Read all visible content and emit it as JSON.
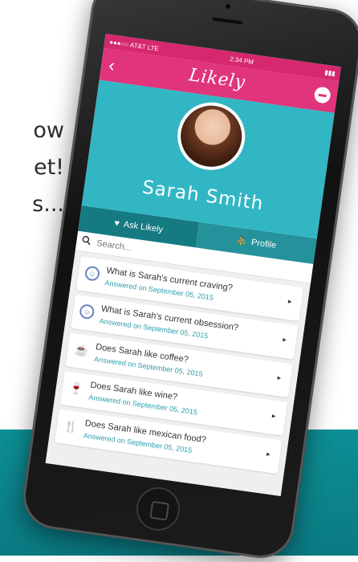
{
  "background": {
    "lines": [
      "ow",
      "et!",
      "s..."
    ]
  },
  "status_bar": {
    "carrier": "●●●○○ AT&T  LTE",
    "time": "2:34 PM",
    "battery": "▮▮▮"
  },
  "nav": {
    "logo": "Likely",
    "back_icon": "chevron-left-icon",
    "menu_icon": "minus-circle-icon"
  },
  "profile": {
    "name": "Sarah Smith"
  },
  "tabs": [
    {
      "label": "Ask Likely",
      "icon": "heart-icon"
    },
    {
      "label": "Profile",
      "icon": "person-icon"
    }
  ],
  "search": {
    "placeholder": "Search..."
  },
  "items": [
    {
      "icon": "smile-icon",
      "question": "What is Sarah's current craving?",
      "answered": "Answered on September 05, 2015"
    },
    {
      "icon": "smile-icon",
      "question": "What is Sarah's current obsession?",
      "answered": "Answered on September 05, 2015"
    },
    {
      "icon": "coffee-icon",
      "question": "Does Sarah like coffee?",
      "answered": "Answered on September 05, 2015"
    },
    {
      "icon": "wine-icon",
      "question": "Does Sarah like wine?",
      "answered": "Answered on September 05, 2015"
    },
    {
      "icon": "fork-icon",
      "question": "Does Sarah like mexican food?",
      "answered": "Answered on September 05, 2015"
    }
  ],
  "colors": {
    "accent_pink": "#e0347c",
    "teal": "#33b6c4",
    "teal_dark": "#157a82",
    "band": "#0e8e95"
  }
}
